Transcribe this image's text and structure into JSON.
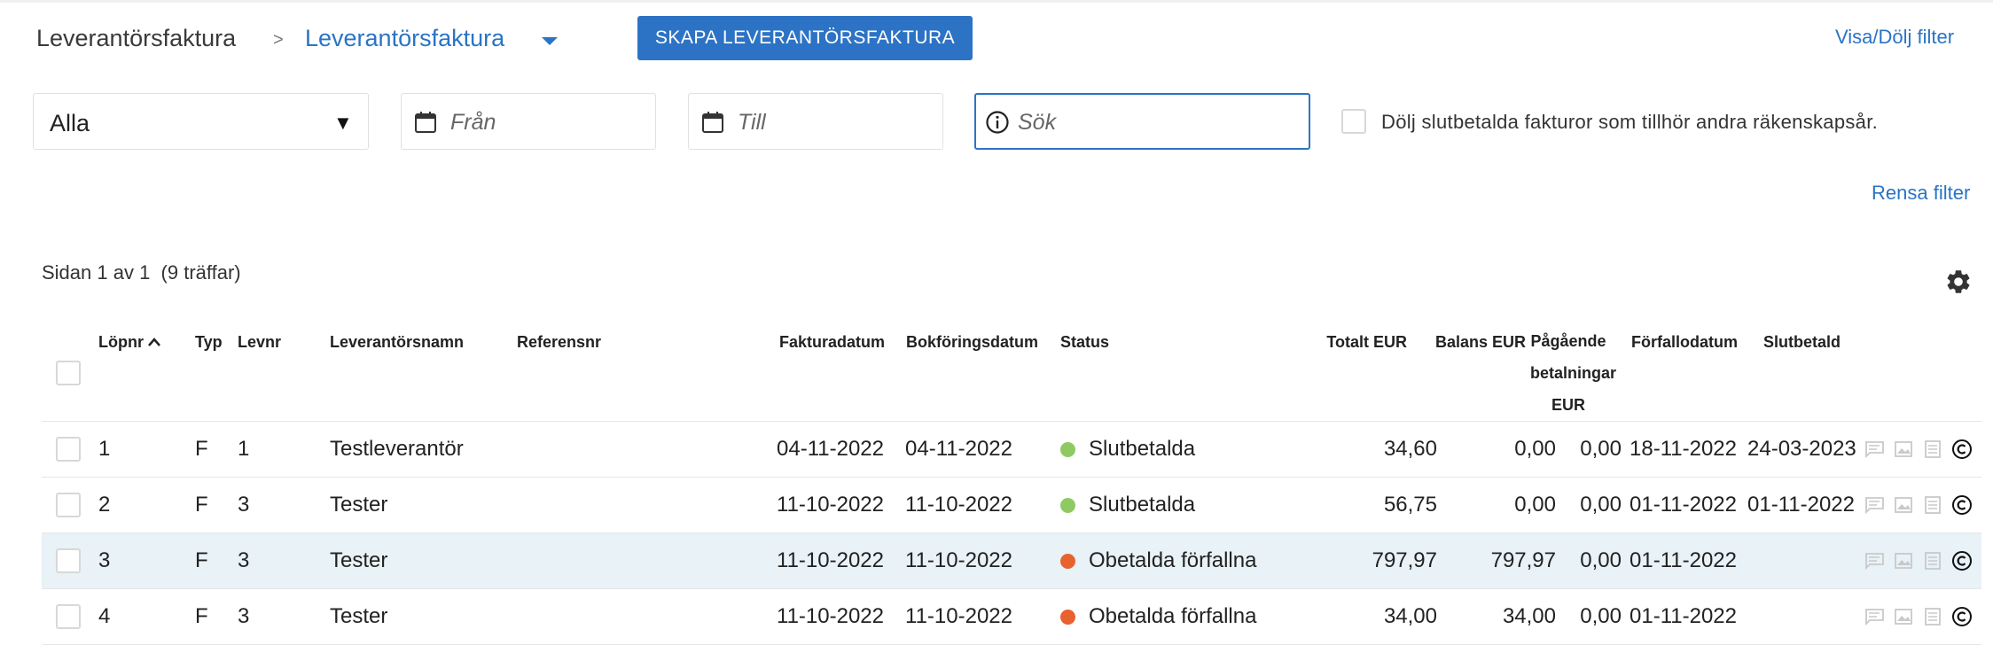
{
  "breadcrumb": {
    "root": "Leverantörsfaktura",
    "separator": ">",
    "current": "Leverantörsfaktura"
  },
  "toolbar": {
    "create_label": "SKAPA LEVERANTÖRSFAKTURA",
    "toggle_filter_label": "Visa/Dölj filter"
  },
  "filters": {
    "type_select_value": "Alla",
    "from_placeholder": "Från",
    "to_placeholder": "Till",
    "search_placeholder": "Sök",
    "hide_paid_label": "Dölj slutbetalda fakturor som tillhör andra räkenskapsår.",
    "clear_label": "Rensa filter"
  },
  "pagination": {
    "text": "Sidan 1 av 1  (9 träffar)"
  },
  "table": {
    "headers": {
      "lopnr": "Löpnr",
      "typ": "Typ",
      "levnr": "Levnr",
      "name": "Leverantörsnamn",
      "ref": "Referensnr",
      "fakturadatum": "Fakturadatum",
      "bokforingsdatum": "Bokföringsdatum",
      "status": "Status",
      "totalt": "Totalt EUR",
      "balans": "Balans EUR",
      "pagaende_1": "Pågående",
      "pagaende_2": "betalningar",
      "pagaende_3": "EUR",
      "forfallodatum": "Förfallodatum",
      "slutbetald": "Slutbetald"
    },
    "rows": [
      {
        "lopnr": "1",
        "typ": "F",
        "levnr": "1",
        "name": "Testleverantör",
        "ref": "",
        "fakturadatum": "04-11-2022",
        "bokforingsdatum": "04-11-2022",
        "status": "Slutbetalda",
        "status_color": "#8fc963",
        "totalt": "34,60",
        "balans": "0,00",
        "pagaende": "0,00",
        "forfallodatum": "18-11-2022",
        "slutbetald": "24-03-2023"
      },
      {
        "lopnr": "2",
        "typ": "F",
        "levnr": "3",
        "name": "Tester",
        "ref": "",
        "fakturadatum": "11-10-2022",
        "bokforingsdatum": "11-10-2022",
        "status": "Slutbetalda",
        "status_color": "#8fc963",
        "totalt": "56,75",
        "balans": "0,00",
        "pagaende": "0,00",
        "forfallodatum": "01-11-2022",
        "slutbetald": "01-11-2022"
      },
      {
        "lopnr": "3",
        "typ": "F",
        "levnr": "3",
        "name": "Tester",
        "ref": "",
        "fakturadatum": "11-10-2022",
        "bokforingsdatum": "11-10-2022",
        "status": "Obetalda förfallna",
        "status_color": "#e8622f",
        "totalt": "797,97",
        "balans": "797,97",
        "pagaende": "0,00",
        "forfallodatum": "01-11-2022",
        "slutbetald": ""
      },
      {
        "lopnr": "4",
        "typ": "F",
        "levnr": "3",
        "name": "Tester",
        "ref": "",
        "fakturadatum": "11-10-2022",
        "bokforingsdatum": "11-10-2022",
        "status": "Obetalda förfallna",
        "status_color": "#e8622f",
        "totalt": "34,00",
        "balans": "34,00",
        "pagaende": "0,00",
        "forfallodatum": "01-11-2022",
        "slutbetald": ""
      }
    ],
    "row_icons": [
      "comment-icon",
      "image-icon",
      "list-icon",
      "copyright-icon"
    ]
  },
  "colors": {
    "accent": "#2a74c5",
    "highlight_row": "#e8f2f7",
    "paid": "#8fc963",
    "overdue": "#e8622f"
  }
}
